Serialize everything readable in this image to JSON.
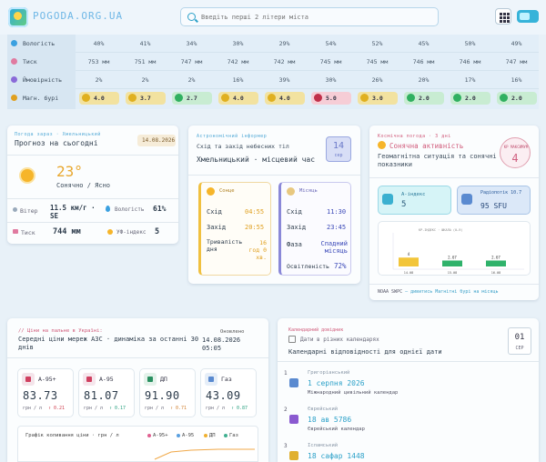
{
  "header": {
    "logo_text": "POGODA.ORG.UA",
    "search_placeholder": "Введіть перші 2 літери міста"
  },
  "weather_table": {
    "rows": [
      {
        "label": "Вологість",
        "icon": "droplet-icon",
        "color": "#3aa0e0",
        "values": [
          "40%",
          "41%",
          "34%",
          "30%",
          "29%",
          "54%",
          "52%",
          "45%",
          "50%",
          "49%"
        ]
      },
      {
        "label": "Тиск",
        "icon": "pressure-icon",
        "color": "#e07aa0",
        "values": [
          "753 мм",
          "751 мм",
          "747 мм",
          "742 мм",
          "742 мм",
          "745 мм",
          "745 мм",
          "746 мм",
          "746 мм",
          "747 мм"
        ]
      },
      {
        "label": "Ймовірність",
        "icon": "umbrella-icon",
        "color": "#8a6ad8",
        "values": [
          "2%",
          "2%",
          "2%",
          "16%",
          "39%",
          "30%",
          "26%",
          "20%",
          "17%",
          "16%"
        ]
      }
    ],
    "storm_row": {
      "label": "Магн. бурі",
      "icon": "magnet-icon",
      "values": [
        {
          "v": "4.0",
          "c": "#f2e2a0",
          "d": "#e0b020"
        },
        {
          "v": "3.7",
          "c": "#f2e2a0",
          "d": "#e0b020"
        },
        {
          "v": "2.7",
          "c": "#c8ecd2",
          "d": "#30b060"
        },
        {
          "v": "4.0",
          "c": "#f2e2a0",
          "d": "#e0b020"
        },
        {
          "v": "4.0",
          "c": "#f2e2a0",
          "d": "#e0b020"
        },
        {
          "v": "5.0",
          "c": "#f6cdd6",
          "d": "#c0304a"
        },
        {
          "v": "3.0",
          "c": "#f2e2a0",
          "d": "#e0b020"
        },
        {
          "v": "2.0",
          "c": "#c8ecd2",
          "d": "#30b060"
        },
        {
          "v": "2.0",
          "c": "#c8ecd2",
          "d": "#30b060"
        },
        {
          "v": "2.0",
          "c": "#c8ecd2",
          "d": "#30b060"
        }
      ]
    }
  },
  "today": {
    "tag": "Погода зараз · Хмельницький",
    "title": "Прогноз на сьогодні",
    "date": "14.08.2026",
    "temp": "23°",
    "desc": "Сонячно / Ясно",
    "wind_label": "Вітер",
    "wind_value": "11.5 км/г · SE",
    "humidity_label": "Вологість",
    "humidity_value": "61%",
    "pressure_label": "Тиск",
    "pressure_value": "744 мм",
    "uv_label": "УФ-індекс",
    "uv_value": "5"
  },
  "astro": {
    "tag": "Астрономічний інформер",
    "title": "Схід та захід небесних тіл",
    "city": "Хмельницький · місцевий час",
    "day_num": "14",
    "day_name": "сер",
    "sun_title": "Сонце",
    "sun_rise_label": "Схід",
    "sun_rise": "04:55",
    "sun_set_label": "Захід",
    "sun_set": "20:55",
    "day_len_label": "Тривалість дня",
    "day_len": "16 год 0 хв.",
    "moon_title": "Місяць",
    "moon_rise_label": "Схід",
    "moon_rise": "11:30",
    "moon_set_label": "Захід",
    "moon_set": "23:45",
    "phase_label": "Фаза",
    "phase": "Спадний місяць",
    "illum_label": "Освітленість",
    "illum": "72%"
  },
  "solar": {
    "tag": "Космічна погода · 3 дні",
    "title": "Сонячна активність",
    "desc": "Геомагнітна ситуація та сонячні показники",
    "max_label": "КР МАКСИМУМ",
    "max_value": "4",
    "a_label": "A-індекс",
    "a_value": "5",
    "radio_label": "Радіопотік 10.7",
    "radio_value": "95 SFU",
    "footer_src": "NOAA SWPC",
    "footer_link": "— дивитись Магнітні бурі на місяць"
  },
  "chart_data": {
    "type": "bar",
    "title": "КР-ІНДЕКС · ШКАЛА (0–9)",
    "categories": [
      "14.08",
      "15.08",
      "16.08"
    ],
    "values": [
      4,
      2.67,
      2.67
    ],
    "labels": [
      "4",
      "2.67",
      "2.67"
    ],
    "ylim": [
      0,
      9
    ],
    "colors": [
      "#f2c53a",
      "#2fb26b",
      "#2fb26b"
    ],
    "ylabel": ""
  },
  "fuel": {
    "tag": "// Ціни на пальне в Україні:",
    "title": "Середні ціни мереж АЗС · динаміка за останні 30 днів",
    "updated_label": "Оновлено",
    "updated": "14.08.2026 05:05",
    "items": [
      {
        "name": "А-95+",
        "icon": "fuel-premium-icon",
        "price": "83.73",
        "unit": "грн / л",
        "delta": "↑ 0.21",
        "dcolor": "#d04050",
        "bg": "#f4e4ea",
        "ic": "#d04060"
      },
      {
        "name": "А-95",
        "icon": "fuel-pump-icon",
        "price": "81.07",
        "unit": "грн / л",
        "delta": "↑ 0.17",
        "dcolor": "#2aa080",
        "bg": "#f6e6ec",
        "ic": "#d04060"
      },
      {
        "name": "ДП",
        "icon": "truck-icon",
        "price": "91.90",
        "unit": "грн / л",
        "delta": "↑ 0.71",
        "dcolor": "#d08030",
        "bg": "#e4f2ea",
        "ic": "#2a9060"
      },
      {
        "name": "Газ",
        "icon": "gas-icon",
        "price": "43.09",
        "unit": "грн / л",
        "delta": "↑ 0.87",
        "dcolor": "#2aa080",
        "bg": "#e6eef8",
        "ic": "#5a8ad0"
      }
    ],
    "chart_title": "Графік коливання ціни · грн / л",
    "legend": [
      {
        "name": "А-95+",
        "color": "#e06090"
      },
      {
        "name": "А-95",
        "color": "#5aa0e0"
      },
      {
        "name": "ДП",
        "color": "#f0b030"
      },
      {
        "name": "Газ",
        "color": "#40b090"
      }
    ]
  },
  "calendar": {
    "tag": "Календарний довідник",
    "title": "Дати в різних календарях",
    "subtitle": "Календарні відповідності для однієї дати",
    "day_num": "01",
    "day_name": "СЕР",
    "items": [
      {
        "num": "1",
        "sys": "Григоріанський",
        "date": "1 серпня 2026",
        "desc": "Міжнародний цивільний календар",
        "icon": "calendar-icon",
        "ic": "#5a8ad0"
      },
      {
        "num": "2",
        "sys": "Єврейський",
        "date": "18 ав 5786",
        "desc": "Єврейський календар",
        "icon": "star-of-david-icon",
        "ic": "#8a5ad0"
      },
      {
        "num": "3",
        "sys": "Ісламський",
        "date": "18 сафар 1448",
        "desc": "",
        "icon": "crescent-icon",
        "ic": "#e0b030"
      }
    ]
  }
}
